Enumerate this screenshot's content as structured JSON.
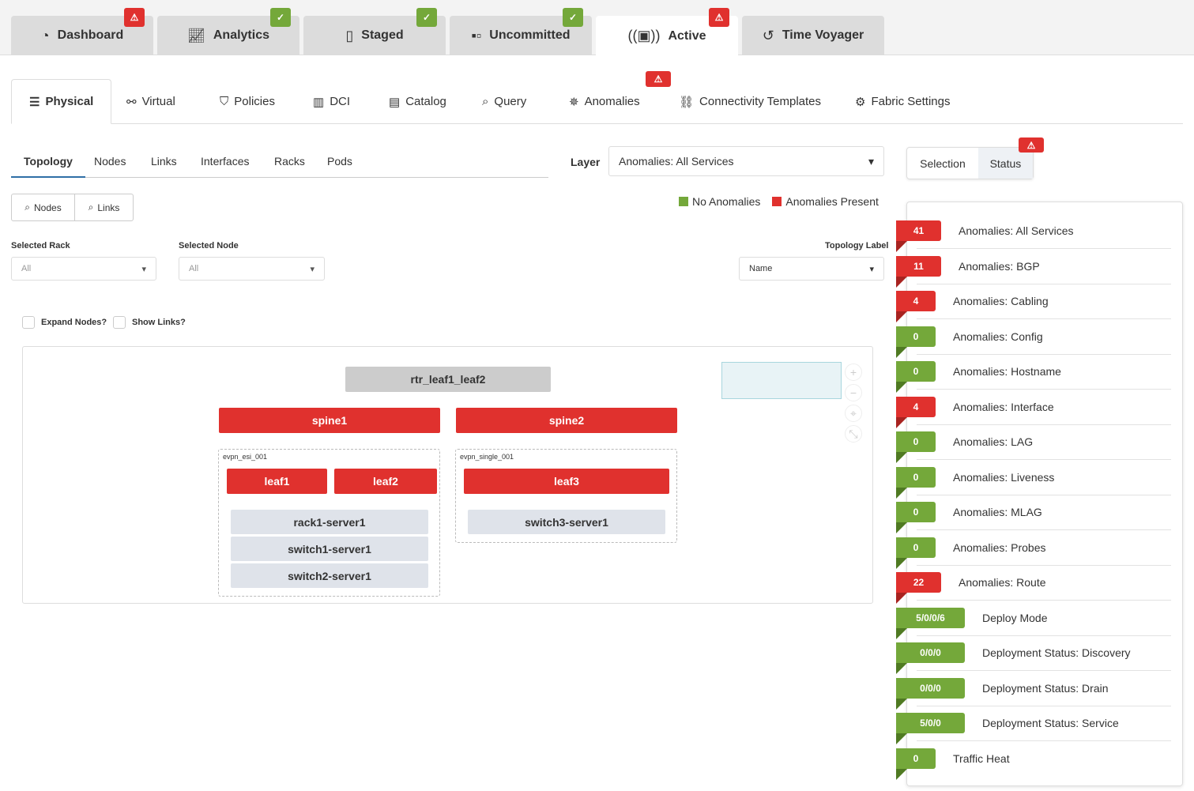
{
  "top_tabs": [
    {
      "label": "Dashboard",
      "icon": "dashboard-icon",
      "badge": "alert"
    },
    {
      "label": "Analytics",
      "icon": "chart-line-icon",
      "badge": "ok"
    },
    {
      "label": "Staged",
      "icon": "document-icon",
      "badge": "ok"
    },
    {
      "label": "Uncommitted",
      "icon": "uncommitted-icon",
      "badge": "ok"
    },
    {
      "label": "Active",
      "icon": "broadcast-icon",
      "badge": "alert",
      "active": true
    },
    {
      "label": "Time Voyager",
      "icon": "history-icon"
    }
  ],
  "nav": [
    {
      "label": "Physical",
      "icon": "server-icon",
      "active": true
    },
    {
      "label": "Virtual",
      "icon": "network-icon"
    },
    {
      "label": "Policies",
      "icon": "shield-icon"
    },
    {
      "label": "DCI",
      "icon": "dci-icon"
    },
    {
      "label": "Catalog",
      "icon": "catalog-icon"
    },
    {
      "label": "Query",
      "icon": "query-icon"
    },
    {
      "label": "Anomalies",
      "icon": "anomalies-icon",
      "badge": "alert"
    },
    {
      "label": "Connectivity Templates",
      "icon": "templates-icon"
    },
    {
      "label": "Fabric Settings",
      "icon": "settings-icon"
    }
  ],
  "subtabs": [
    "Topology",
    "Nodes",
    "Links",
    "Interfaces",
    "Racks",
    "Pods"
  ],
  "search_buttons": [
    "Nodes",
    "Links"
  ],
  "layer": {
    "label": "Layer",
    "value": "Anomalies: All Services"
  },
  "legend": {
    "no": "No Anomalies",
    "yes": "Anomalies Present",
    "colors": {
      "no": "#74a83a",
      "yes": "#e0312e"
    }
  },
  "filters": {
    "rack_label": "Selected Rack",
    "rack_value": "All",
    "node_label": "Selected Node",
    "node_value": "All",
    "topo_label": "Topology Label",
    "topo_value": "Name"
  },
  "checks": [
    "Expand Nodes?",
    "Show Links?"
  ],
  "topology": {
    "router": "rtr_leaf1_leaf2",
    "spines": [
      "spine1",
      "spine2"
    ],
    "groups": [
      {
        "name": "evpn_esi_001",
        "leafs": [
          "leaf1",
          "leaf2"
        ],
        "servers": [
          "rack1-server1",
          "switch1-server1",
          "switch2-server1"
        ]
      },
      {
        "name": "evpn_single_001",
        "leafs": [
          "leaf3"
        ],
        "servers": [
          "switch3-server1"
        ]
      }
    ]
  },
  "panel_tabs": [
    "Selection",
    "Status"
  ],
  "status_rows": [
    {
      "count": "41",
      "label": "Anomalies: All Services",
      "color": "red"
    },
    {
      "count": "11",
      "label": "Anomalies: BGP",
      "color": "red"
    },
    {
      "count": "4",
      "label": "Anomalies: Cabling",
      "color": "red"
    },
    {
      "count": "0",
      "label": "Anomalies: Config",
      "color": "green"
    },
    {
      "count": "0",
      "label": "Anomalies: Hostname",
      "color": "green"
    },
    {
      "count": "4",
      "label": "Anomalies: Interface",
      "color": "red"
    },
    {
      "count": "0",
      "label": "Anomalies: LAG",
      "color": "green"
    },
    {
      "count": "0",
      "label": "Anomalies: Liveness",
      "color": "green"
    },
    {
      "count": "0",
      "label": "Anomalies: MLAG",
      "color": "green"
    },
    {
      "count": "0",
      "label": "Anomalies: Probes",
      "color": "green"
    },
    {
      "count": "22",
      "label": "Anomalies: Route",
      "color": "red"
    },
    {
      "count": "5/0/0/6",
      "label": "Deploy Mode",
      "color": "green"
    },
    {
      "count": "0/0/0",
      "label": "Deployment Status: Discovery",
      "color": "green"
    },
    {
      "count": "0/0/0",
      "label": "Deployment Status: Drain",
      "color": "green"
    },
    {
      "count": "5/0/0",
      "label": "Deployment Status: Service",
      "color": "green"
    },
    {
      "count": "0",
      "label": "Traffic Heat",
      "color": "green"
    }
  ]
}
